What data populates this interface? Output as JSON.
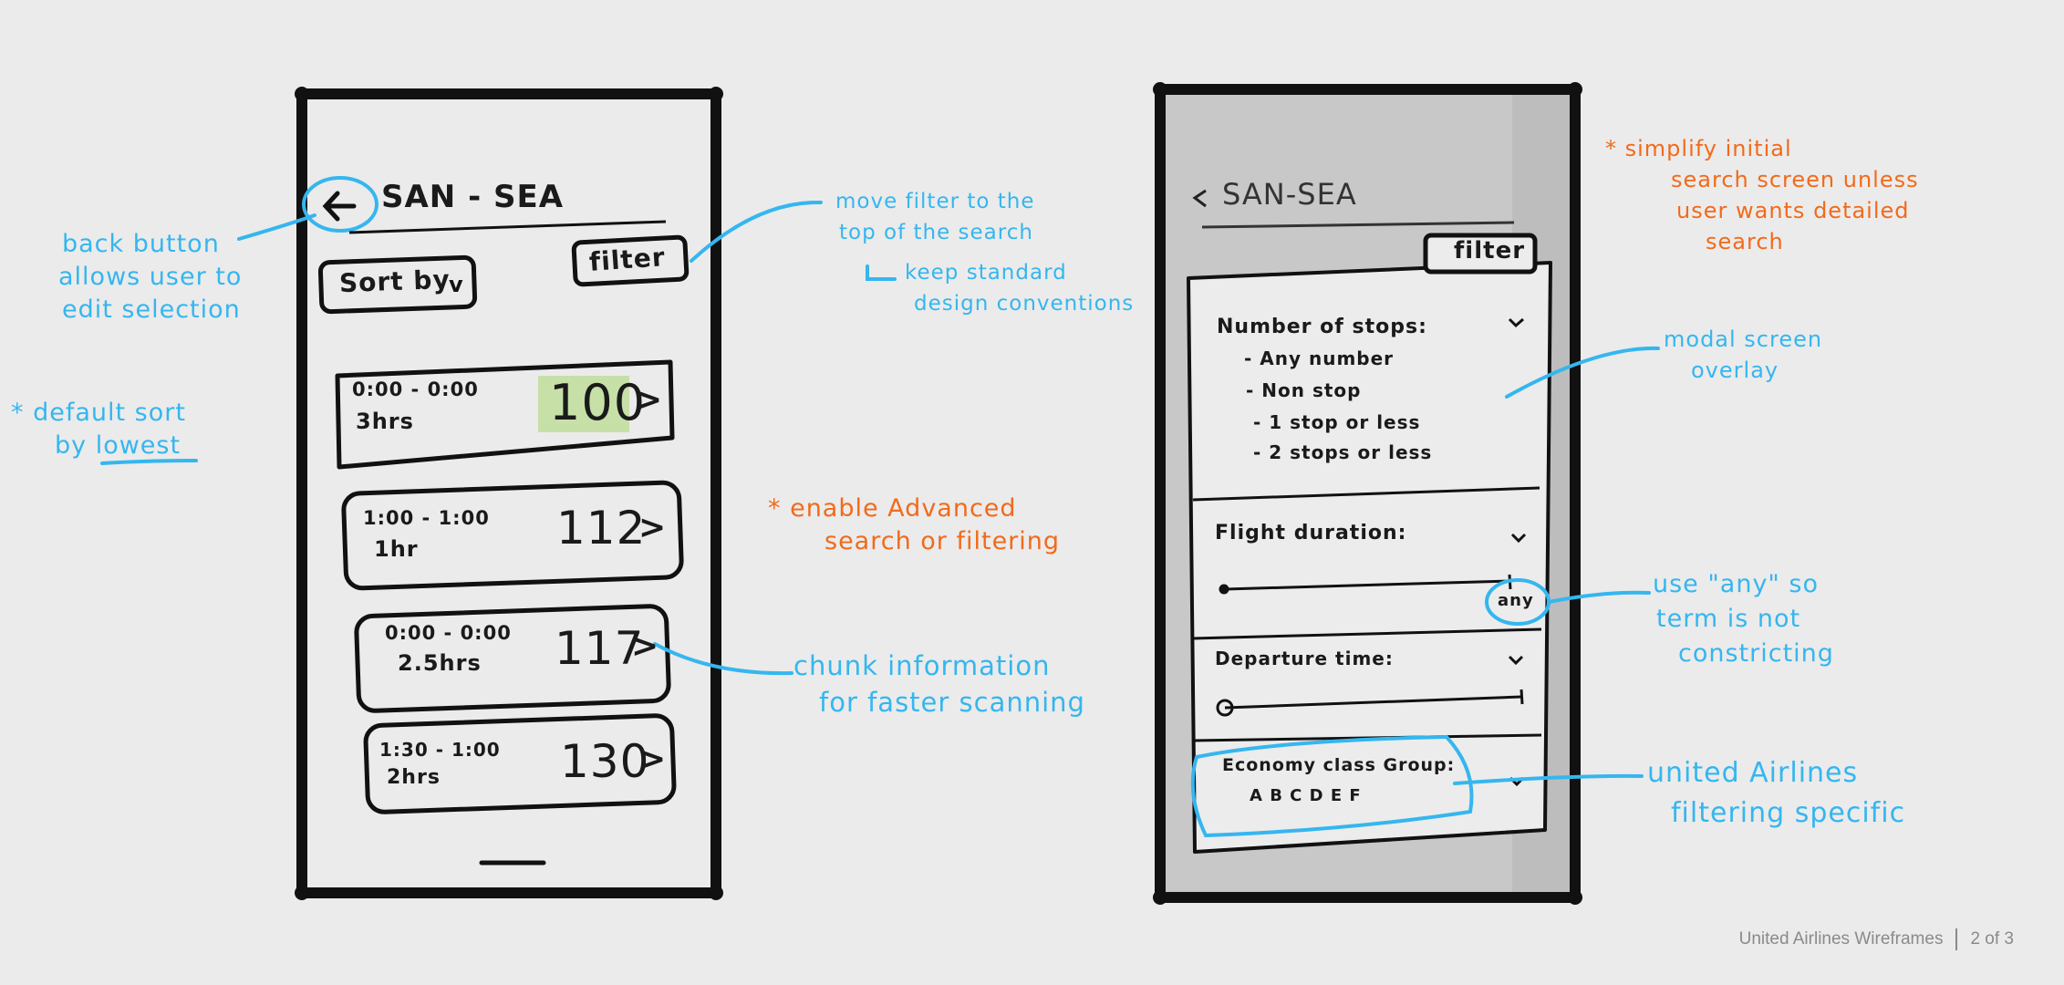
{
  "colors": {
    "annotation_blue": "#35b6ef",
    "annotation_orange": "#f26a1b",
    "ink": "#1a1a1a",
    "price_highlight": "#c6e0a8",
    "modal_shade": "#c4c4c4"
  },
  "left_screen": {
    "title": "SAN - SEA",
    "back_icon": "back-arrow-icon",
    "sort_label": "Sort by",
    "filter_label": "filter",
    "flights": [
      {
        "time": "0:00 - 0:00",
        "duration": "3hrs",
        "price": "100"
      },
      {
        "time": "1:00 - 1:00",
        "duration": "1hr",
        "price": "112"
      },
      {
        "time": "0:00 - 0:00",
        "duration": "2.5hrs",
        "price": "117"
      },
      {
        "time": "1:30 - 1:00",
        "duration": "2hrs",
        "price": "130"
      }
    ]
  },
  "right_screen": {
    "title": "SAN-SEA",
    "back_icon": "back-arrow-icon",
    "filter_label": "filter",
    "stops_heading": "Number of stops:",
    "stops_options": [
      "- Any number",
      "- Non stop",
      "- 1 stop or less",
      "- 2 stops or less"
    ],
    "duration_heading": "Flight duration:",
    "duration_value": "any",
    "departure_heading": "Departure time:",
    "economy_heading": "Economy class Group:",
    "economy_groups": "A B C D E F"
  },
  "annotations": {
    "back_button": [
      "back button",
      "allows user to",
      "edit selection"
    ],
    "default_sort": [
      "* default sort",
      "by lowest"
    ],
    "move_filter": [
      "move filter to the",
      "top of the search"
    ],
    "keep_standard": [
      "keep standard",
      "design conventions"
    ],
    "enable_advanced": [
      "* enable Advanced",
      "search or filtering"
    ],
    "chunk_info": [
      "chunk information",
      "for faster scanning"
    ],
    "simplify": [
      "* simplify initial",
      "search screen unless",
      "user wants detailed",
      "search"
    ],
    "modal": [
      "modal screen",
      "overlay"
    ],
    "use_any": [
      "use \"any\" so",
      "term is not",
      "constricting"
    ],
    "united_specific": [
      "united Airlines",
      "filtering specific"
    ]
  },
  "footer": {
    "title": "United Airlines Wireframes",
    "page": "2 of 3"
  }
}
